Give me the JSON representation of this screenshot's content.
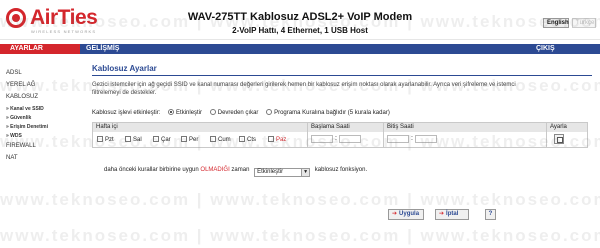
{
  "brand": {
    "name": "AirTies",
    "tagline": "WIRELESS NETWORKS"
  },
  "header": {
    "title": "WAV-275TT Kablosuz ADSL2+ VoIP Modem",
    "subtitle": "2-VoIP Hattı, 4 Ethernet, 1 USB Host",
    "lang_en": "English",
    "lang_tr": "Türkçe"
  },
  "topnav": {
    "settings": "AYARLAR",
    "advanced": "GELİŞMİŞ",
    "logout": "ÇIKIŞ"
  },
  "sidebar": {
    "items": [
      "ADSL",
      "YEREL AĞ",
      "KABLOSUZ"
    ],
    "sub": [
      "» Kanal ve SSID",
      "» Güvenlik",
      "» Erişim Denetimi",
      "» WDS"
    ],
    "items2": [
      "FIREWALL",
      "NAT"
    ]
  },
  "main": {
    "title": "Kablosuz Ayarlar",
    "description": "Gezici istemciler için ağ geçidi SSID ve kanal numarası değerleri girilerek hemen bir kablosuz erişim noktası olarak ayarlanabilir. Ayrıca veri şifreleme ve istemci filtrelemeyi de destekler.",
    "status_label": "Kablosuz işlevi etkinleştir:",
    "radio_options": [
      "Etkinleştir",
      "Devreden çıkar",
      "Programa Kuralına bağlıdır (5 kurala kadar)"
    ],
    "radio_selected": 0,
    "table": {
      "headers": [
        "Hafta içi",
        "Başlama Saati",
        "Bitiş Saati",
        "Ayarla"
      ],
      "days": [
        "Pzt",
        "Sal",
        "Çar",
        "Per",
        "Cum",
        "Cts",
        "Paz"
      ],
      "start_sep": ":",
      "end_sep": ":"
    },
    "rule_prefix": "daha önceki kurallar birbirine uygun",
    "rule_warn": "OLMADIĞI",
    "rule_mid": "zaman",
    "rule_select": "Etkinleştir",
    "rule_suffix": "kablosuz fonksiyon.",
    "buttons": {
      "save": "Uygula",
      "cancel": "İptal",
      "help": "?"
    }
  },
  "watermark": "www.teknoseo.com | www.teknoseo.com | www.teknoseo.com",
  "colors": {
    "brand_red": "#d4262c",
    "nav_blue": "#2c4a93"
  }
}
